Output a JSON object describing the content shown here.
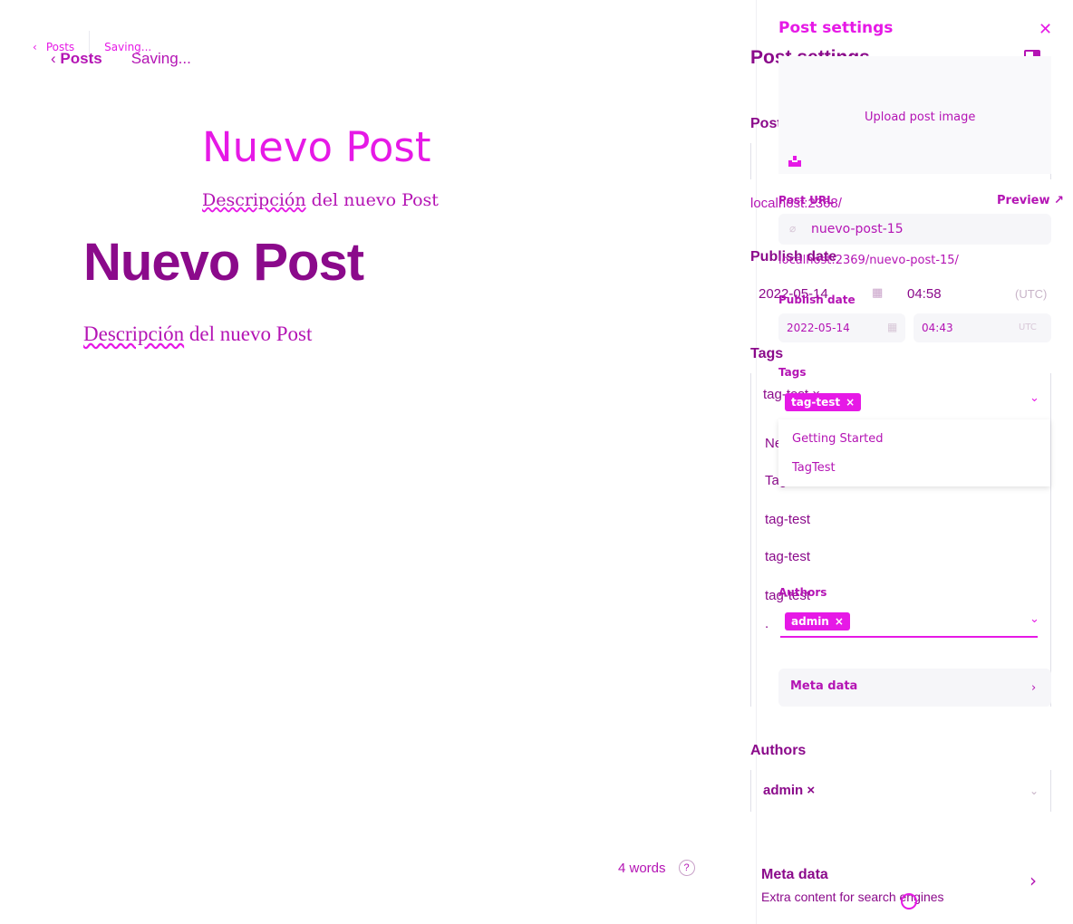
{
  "nav": {
    "back_label": "Posts",
    "status": "Saving..."
  },
  "editor": {
    "title": "Nuevo Post",
    "description_word1": "Descripción",
    "description_rest": " del nuevo Post",
    "word_count": "4 words",
    "help_icon": "?"
  },
  "settings_back": {
    "title": "Post settings",
    "post_url_label": "Post URL",
    "url_prefix": "localhost:2368/",
    "publish_date_label": "Publish date",
    "date": "2022-05-14",
    "time": "04:58",
    "timezone": "(UTC)",
    "tags_label": "Tags",
    "tag_value": "tag-test ×",
    "tag_list": [
      "News",
      "Tag1",
      "tag-test",
      "tag-test",
      "tag-test",
      "."
    ],
    "authors_label": "Authors",
    "author_value": "admin ×",
    "meta_title": "Meta data",
    "meta_desc": "Extra content for search engines"
  },
  "settings_front": {
    "title": "Post settings",
    "upload_label": "Upload post image",
    "post_url_label": "Post URL",
    "preview_label": "Preview",
    "slug": "nuevo-post-15",
    "full_url": "localhost:2369/nuevo-post-15/",
    "publish_date_label": "Publish date",
    "date": "2022-05-14",
    "time": "04:43",
    "timezone": "UTC",
    "tags_label": "Tags",
    "tag_chip": "tag-test",
    "dropdown_options": [
      "Getting Started",
      "TagTest"
    ],
    "authors_label": "Authors",
    "author_chip": "admin",
    "meta_label": "Meta data"
  },
  "colors": {
    "accent": "#e619e6",
    "dark": "#8b0a8b",
    "mid": "#b414b4"
  }
}
